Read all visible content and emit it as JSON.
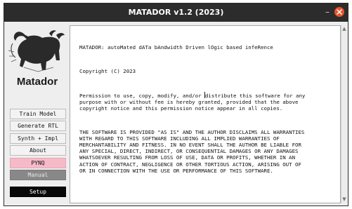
{
  "window": {
    "title": "MATADOR v1.2 (2023)",
    "minimize_glyph": "–"
  },
  "logo": {
    "text": "Matador",
    "icon": "bull-icon"
  },
  "sidebar": {
    "buttons": [
      {
        "label": "Train Model"
      },
      {
        "label": "Generate RTL"
      },
      {
        "label": "Synth + Impl"
      },
      {
        "label": "About"
      },
      {
        "label": "PYNQ"
      },
      {
        "label": "Manual"
      },
      {
        "label": "Setup"
      }
    ]
  },
  "license": {
    "line1": "MATADOR: autoMated dATa bAndwidth Driven lOgic based infeRence",
    "copyright": "Copyright (C) 2023",
    "perm_a": "Permission to use, copy, modify, and/or ",
    "perm_b": "distribute this software for any",
    "perm2": "purpose with or without fee is hereby granted, provided that the above",
    "perm3": "copyright notice and this permission notice appear in all copies.",
    "w1": "THE SOFTWARE IS PROVIDED \"AS IS\" AND THE AUTHOR DISCLAIMS ALL WARRANTIES",
    "w2": "WITH REGARD TO THIS SOFTWARE INCLUDING ALL IMPLIED WARRANTIES OF",
    "w3": "MERCHANTABILITY AND FITNESS. IN NO EVENT SHALL THE AUTHOR BE LIABLE FOR",
    "w4": "ANY SPECIAL, DIRECT, INDIRECT, OR CONSEQUENTIAL DAMAGES OR ANY DAMAGES",
    "w5": "WHATSOEVER RESULTING FROM LOSS OF USE, DATA OR PROFITS, WHETHER IN AN",
    "w6": "ACTION OF CONTRACT, NEGLIGENCE OR OTHER TORTIOUS ACTION, ARISING OUT OF",
    "w7": "OR IN CONNECTION WITH THE USE OR PERFORMANCE OF THIS SOFTWARE."
  },
  "colors": {
    "titlebar": "#2c2c2c",
    "close": "#e9542b",
    "pynq": "#f6b9c8",
    "manual": "#888888",
    "setup": "#080808"
  }
}
